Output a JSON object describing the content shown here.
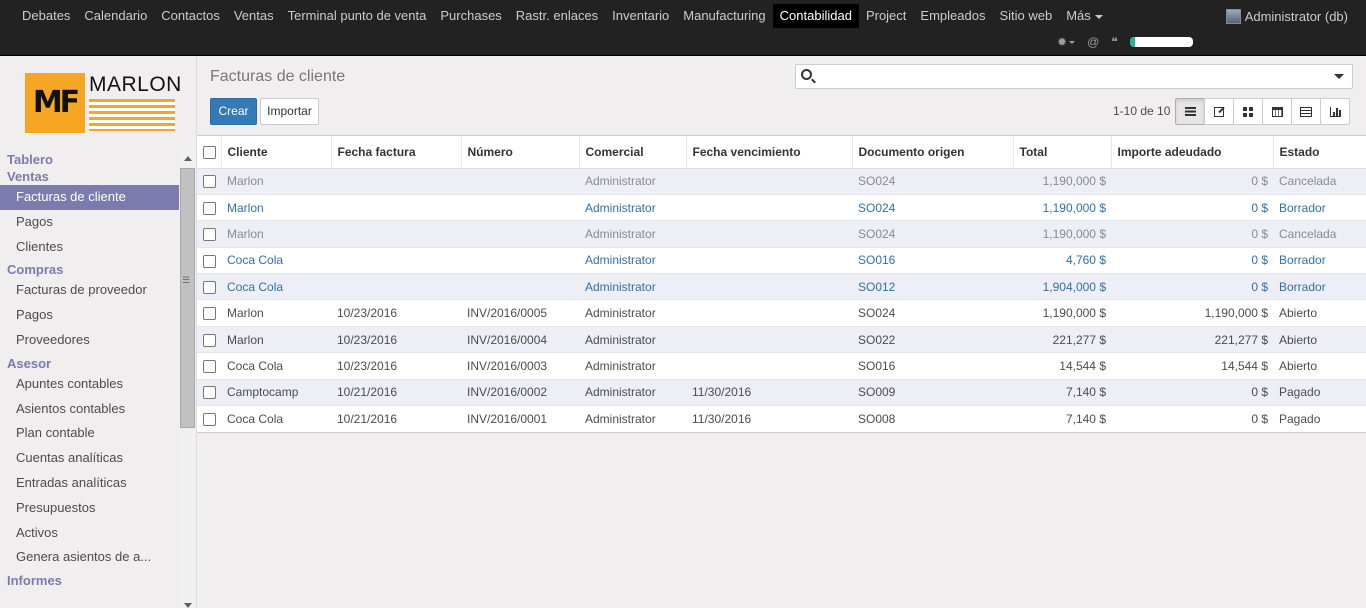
{
  "topmenu": {
    "items": [
      "Debates",
      "Calendario",
      "Contactos",
      "Ventas",
      "Terminal punto de venta",
      "Purchases",
      "Rastr. enlaces",
      "Inventario",
      "Manufacturing",
      "Contabilidad",
      "Project",
      "Empleados",
      "Sitio web"
    ],
    "more_label": "Más",
    "active": "Contabilidad",
    "user_label": "Administrator (db)"
  },
  "systray": {
    "icons": [
      "bug-icon",
      "at-icon",
      "comments-icon"
    ],
    "progress_fraction": 0.08
  },
  "sidebar": {
    "logo_text": "MARLON",
    "logo_mark": "MF",
    "sections": [
      {
        "title": "Tablero",
        "items": []
      },
      {
        "title": "Ventas",
        "items": [
          "Facturas de cliente",
          "Pagos",
          "Clientes"
        ]
      },
      {
        "title": "Compras",
        "items": [
          "Facturas de proveedor",
          "Pagos",
          "Proveedores"
        ]
      },
      {
        "title": "Asesor",
        "items": [
          "Apuntes contables",
          "Asientos contables",
          "Plan contable",
          "Cuentas analíticas",
          "Entradas analíticas",
          "Presupuestos",
          "Activos",
          "Genera asientos de a..."
        ]
      },
      {
        "title": "Informes",
        "items": []
      }
    ],
    "active_item": "Facturas de cliente"
  },
  "control_panel": {
    "title": "Facturas de cliente",
    "search_placeholder": "",
    "create_label": "Crear",
    "import_label": "Importar",
    "pager": "1-10 de 10",
    "views": [
      "list-view-icon",
      "form-view-icon",
      "kanban-view-icon",
      "calendar-view-icon",
      "pivot-view-icon",
      "graph-view-icon"
    ]
  },
  "table": {
    "columns": [
      "Cliente",
      "Fecha factura",
      "Número",
      "Comercial",
      "Fecha vencimiento",
      "Documento origen",
      "Total",
      "Importe adeudado",
      "Estado"
    ],
    "rows": [
      {
        "state": "cancel",
        "cells": [
          "Marlon",
          "",
          "",
          "Administrator",
          "",
          "SO024",
          "1,190,000 $",
          "0 $",
          "Cancelada"
        ]
      },
      {
        "state": "draft",
        "cells": [
          "Marlon",
          "",
          "",
          "Administrator",
          "",
          "SO024",
          "1,190,000 $",
          "0 $",
          "Borrador"
        ]
      },
      {
        "state": "cancel",
        "cells": [
          "Marlon",
          "",
          "",
          "Administrator",
          "",
          "SO024",
          "1,190,000 $",
          "0 $",
          "Cancelada"
        ]
      },
      {
        "state": "draft",
        "cells": [
          "Coca Cola",
          "",
          "",
          "Administrator",
          "",
          "SO016",
          "4,760 $",
          "0 $",
          "Borrador"
        ]
      },
      {
        "state": "draft",
        "cells": [
          "Coca Cola",
          "",
          "",
          "Administrator",
          "",
          "SO012",
          "1,904,000 $",
          "0 $",
          "Borrador"
        ]
      },
      {
        "state": "open",
        "cells": [
          "Marlon",
          "10/23/2016",
          "INV/2016/0005",
          "Administrator",
          "",
          "SO024",
          "1,190,000 $",
          "1,190,000 $",
          "Abierto"
        ]
      },
      {
        "state": "open",
        "cells": [
          "Marlon",
          "10/23/2016",
          "INV/2016/0004",
          "Administrator",
          "",
          "SO022",
          "221,277 $",
          "221,277 $",
          "Abierto"
        ]
      },
      {
        "state": "open",
        "cells": [
          "Coca Cola",
          "10/23/2016",
          "INV/2016/0003",
          "Administrator",
          "",
          "SO016",
          "14,544 $",
          "14,544 $",
          "Abierto"
        ]
      },
      {
        "state": "paid",
        "cells": [
          "Camptocamp",
          "10/21/2016",
          "INV/2016/0002",
          "Administrator",
          "11/30/2016",
          "SO009",
          "7,140 $",
          "0 $",
          "Pagado"
        ]
      },
      {
        "state": "paid",
        "cells": [
          "Coca Cola",
          "10/21/2016",
          "INV/2016/0001",
          "Administrator",
          "11/30/2016",
          "SO008",
          "7,140 $",
          "0 $",
          "Pagado"
        ]
      }
    ]
  },
  "colors": {
    "accent": "#7c7bad",
    "primary_button": "#337ab7",
    "draft_text": "#3071a9",
    "cancel_text": "#8a8a8a"
  }
}
